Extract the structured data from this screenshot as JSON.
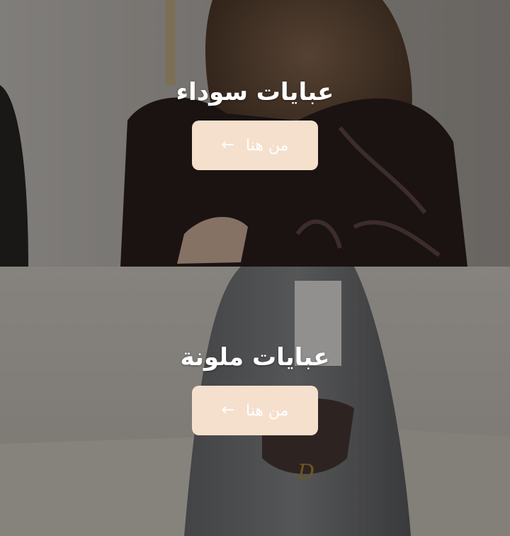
{
  "banners": [
    {
      "title": "عبايات سوداء",
      "cta_label": "من هنا",
      "arrow_icon": "arrow-left-icon"
    },
    {
      "title": "عبايات ملونة",
      "cta_label": "من هنا",
      "arrow_icon": "arrow-left-icon"
    }
  ],
  "colors": {
    "button_background": "#f5e0cd",
    "button_text": "#ffffff",
    "title_text": "#ffffff"
  }
}
